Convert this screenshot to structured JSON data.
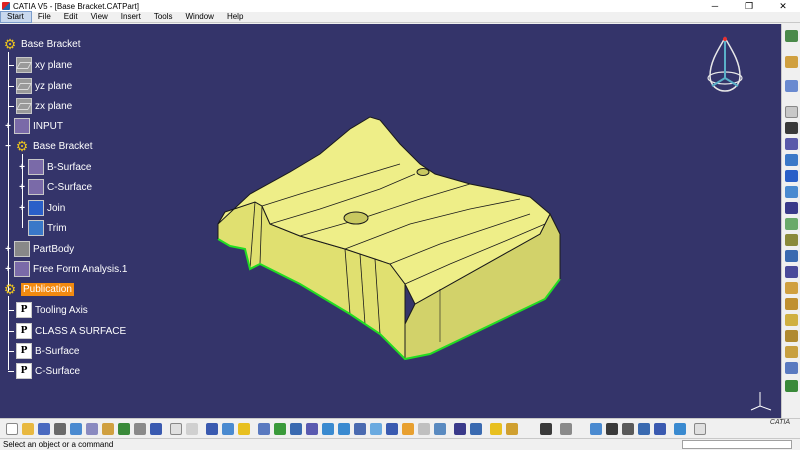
{
  "window": {
    "title": "CATIA V5 - [Base Bracket.CATPart]",
    "min_glyph": "─",
    "restore_glyph": "❐",
    "close_glyph": "✕"
  },
  "menu": [
    "Start",
    "File",
    "Edit",
    "View",
    "Insert",
    "Tools",
    "Window",
    "Help"
  ],
  "tree": {
    "root": "Base Bracket",
    "nodes": [
      {
        "label": "xy plane",
        "icon": "plane-icon"
      },
      {
        "label": "yz plane",
        "icon": "plane-icon"
      },
      {
        "label": "zx plane",
        "icon": "plane-icon"
      },
      {
        "label": "INPUT",
        "icon": "geometrical-set-icon"
      },
      {
        "label": "Base Bracket",
        "icon": "geometrical-set-icon"
      },
      {
        "label": "B-Surface",
        "icon": "surface-icon"
      },
      {
        "label": "C-Surface",
        "icon": "surface-icon"
      },
      {
        "label": "Join",
        "icon": "join-icon"
      },
      {
        "label": "Trim",
        "icon": "trim-icon"
      },
      {
        "label": "PartBody",
        "icon": "body-icon"
      },
      {
        "label": "Free Form Analysis.1",
        "icon": "analysis-icon"
      },
      {
        "label": "Publication",
        "icon": "publication-gear-icon"
      },
      {
        "label": "Tooling Axis",
        "icon": "publication-icon"
      },
      {
        "label": "CLASS A SURFACE",
        "icon": "publication-icon"
      },
      {
        "label": "B-Surface",
        "icon": "publication-icon"
      },
      {
        "label": "C-Surface",
        "icon": "publication-icon"
      }
    ],
    "pub_glyph": "P"
  },
  "status": {
    "text": "Select an object or a command",
    "logo": "CATIA"
  },
  "colors": {
    "viewport": "#34346a",
    "model_top": "#eeee88",
    "model_side": "#dcdc70",
    "model_edge": "#1a1a1a",
    "highlight_edge": "#22dd22",
    "selection": "#f28a10"
  }
}
